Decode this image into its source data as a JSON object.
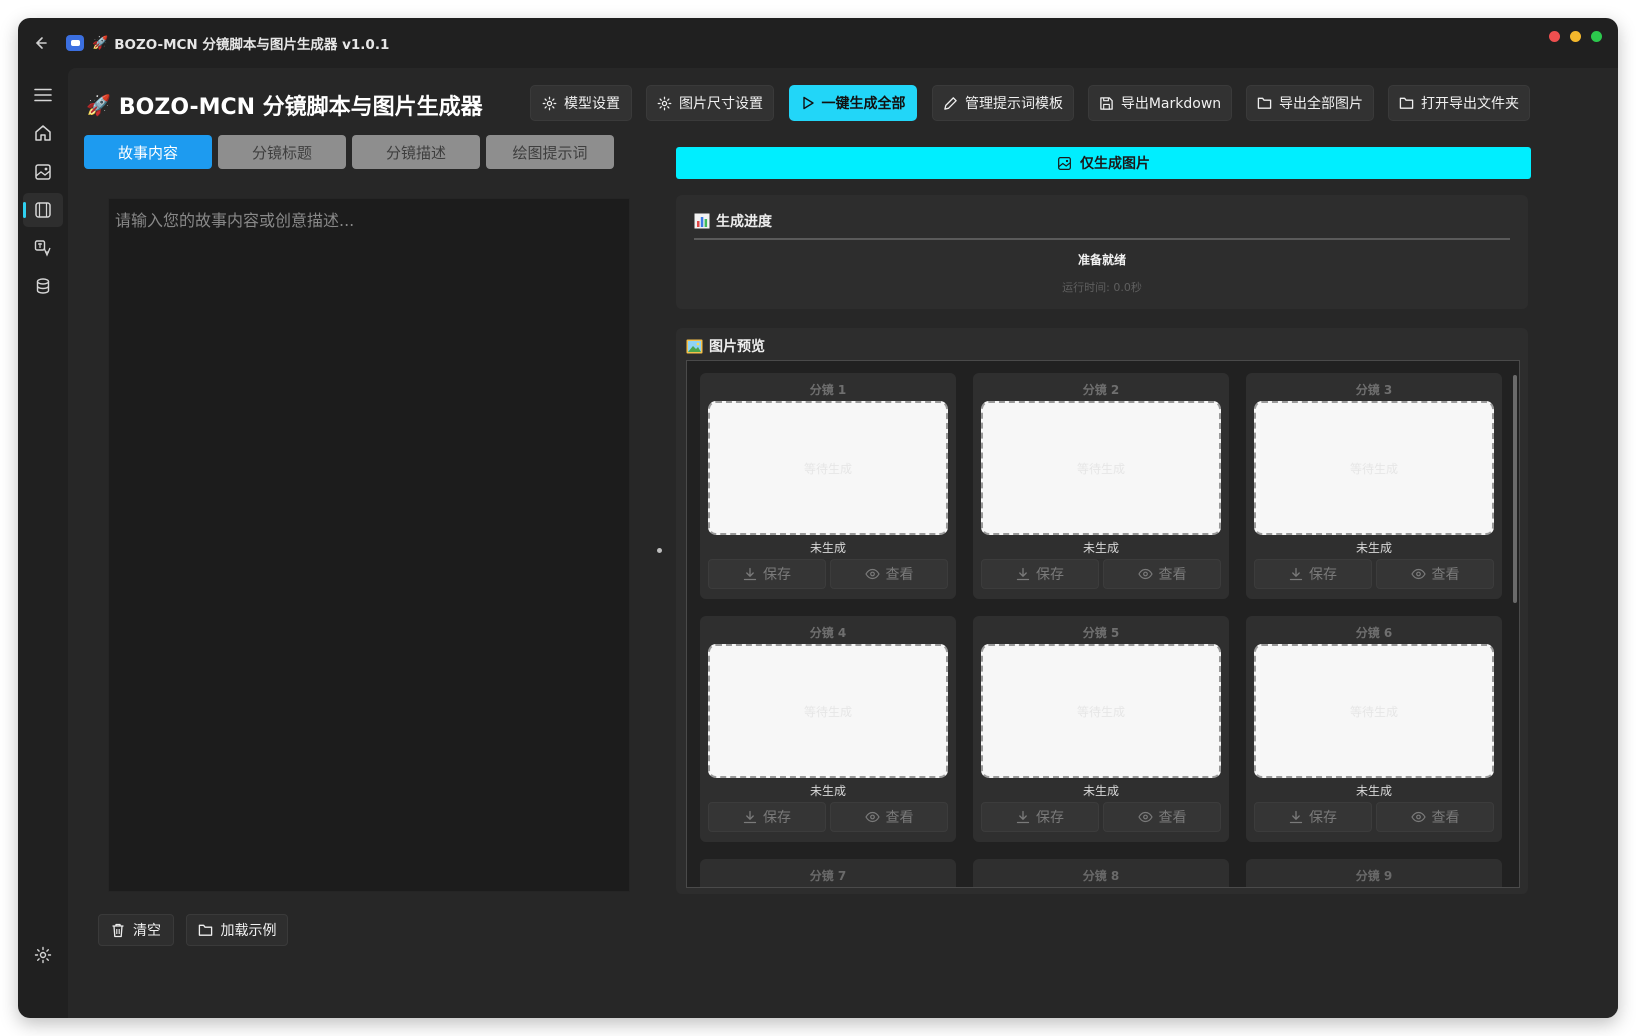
{
  "window": {
    "title": "BOZO-MCN 分镜脚本与图片生成器 v1.0.1",
    "traffic_colors": [
      "#ee4f4f",
      "#f4b82c",
      "#2cc84d"
    ]
  },
  "sidebar": {
    "items": [
      {
        "name": "menu-icon"
      },
      {
        "name": "home-icon"
      },
      {
        "name": "image-icon"
      },
      {
        "name": "storyboard-icon",
        "active": true
      },
      {
        "name": "translate-icon"
      },
      {
        "name": "database-icon"
      },
      {
        "name": "settings-icon"
      }
    ]
  },
  "header": {
    "title": "BOZO-MCN 分镜脚本与图片生成器",
    "rocket": "🚀"
  },
  "toolbar": {
    "model_settings": "模型设置",
    "image_size_settings": "图片尺寸设置",
    "generate_all": "一键生成全部",
    "manage_templates": "管理提示词模板",
    "export_markdown": "导出Markdown",
    "export_all_images": "导出全部图片",
    "open_export_folder": "打开导出文件夹"
  },
  "tabs": [
    "故事内容",
    "分镜标题",
    "分镜描述",
    "绘图提示词"
  ],
  "story": {
    "placeholder": "请输入您的故事内容或创意描述..."
  },
  "bottom": {
    "clear": "清空",
    "load_example": "加载示例"
  },
  "generate_images_only": "仅生成图片",
  "progress": {
    "title": "生成进度",
    "status": "准备就绪",
    "elapsed": "运行时间: 0.0秒"
  },
  "preview": {
    "title": "图片预览",
    "cards": [
      {
        "label": "分镜 1",
        "placeholder": "等待生成",
        "status": "未生成",
        "save": "保存",
        "view": "查看"
      },
      {
        "label": "分镜 2",
        "placeholder": "等待生成",
        "status": "未生成",
        "save": "保存",
        "view": "查看"
      },
      {
        "label": "分镜 3",
        "placeholder": "等待生成",
        "status": "未生成",
        "save": "保存",
        "view": "查看"
      },
      {
        "label": "分镜 4",
        "placeholder": "等待生成",
        "status": "未生成",
        "save": "保存",
        "view": "查看"
      },
      {
        "label": "分镜 5",
        "placeholder": "等待生成",
        "status": "未生成",
        "save": "保存",
        "view": "查看"
      },
      {
        "label": "分镜 6",
        "placeholder": "等待生成",
        "status": "未生成",
        "save": "保存",
        "view": "查看"
      }
    ],
    "partial_labels": [
      "分镜 7",
      "分镜 8",
      "分镜 9"
    ]
  },
  "colors": {
    "accent": "#22d6f8",
    "generate_images_button": "#00eeff",
    "active_tab": "#1d9bf0"
  }
}
